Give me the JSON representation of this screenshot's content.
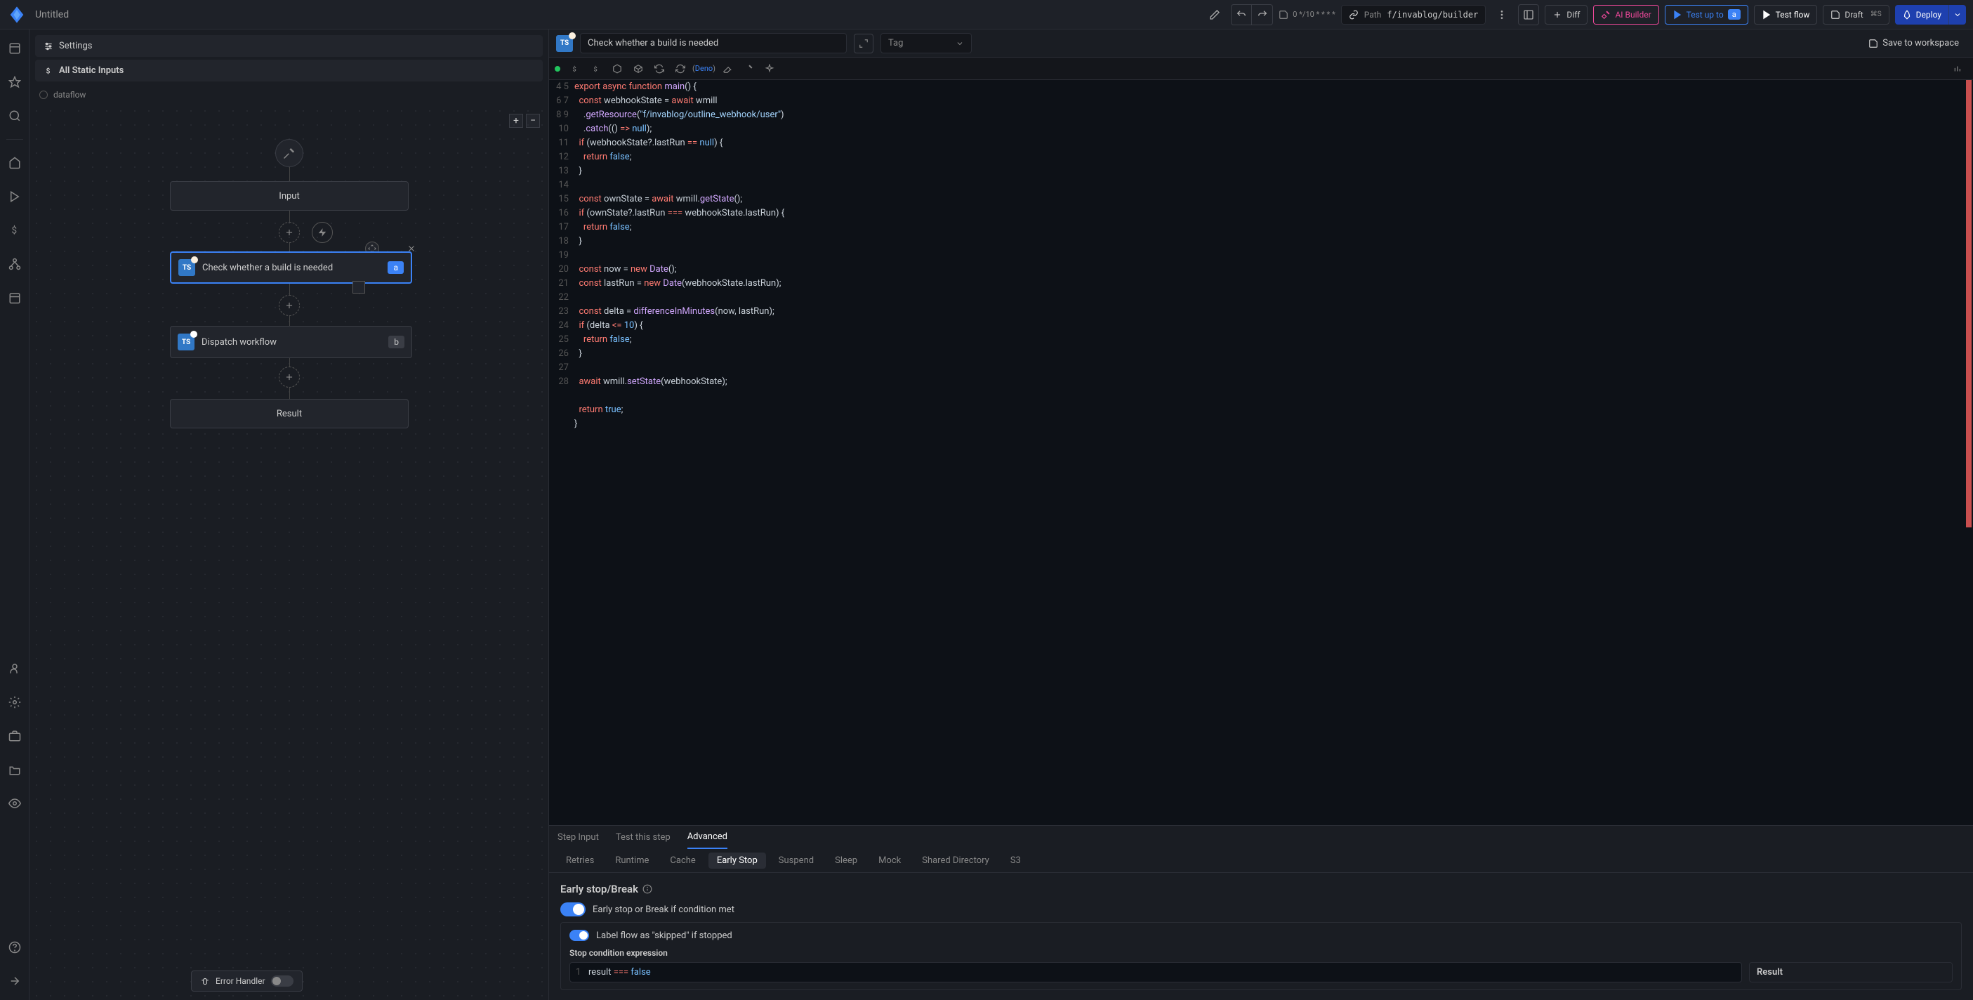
{
  "topbar": {
    "title": "Untitled",
    "save_status": "0 */10 * * * *",
    "path_label": "Path",
    "path_value": "f/invablog/builder",
    "diff_label": "Diff",
    "ai_builder_label": "AI Builder",
    "test_upto_label": "Test up to",
    "test_upto_badge": "a",
    "test_flow_label": "Test flow",
    "draft_label": "Draft",
    "draft_kbd": "⌘S",
    "deploy_label": "Deploy"
  },
  "left": {
    "settings_label": "Settings",
    "inputs_label": "All Static Inputs",
    "dataflow_label": "dataflow",
    "node_input": "Input",
    "node_result": "Result",
    "step_a": {
      "label": "Check whether a build is needed",
      "letter": "a"
    },
    "step_b": {
      "label": "Dispatch workflow",
      "letter": "b"
    },
    "error_handler": "Error Handler"
  },
  "right": {
    "step_name": "Check whether a build is needed",
    "tag_placeholder": "Tag",
    "save_workspace": "Save to workspace",
    "deno_label_prefix": "(",
    "deno_label_lang": "Deno",
    "deno_label_suffix": ")",
    "code": {
      "lines": [
        4,
        5,
        6,
        7,
        8,
        9,
        10,
        11,
        12,
        13,
        14,
        15,
        16,
        17,
        18,
        19,
        20,
        21,
        22,
        23,
        24,
        25,
        26,
        27,
        28
      ]
    },
    "step_tabs": [
      "Step Input",
      "Test this step",
      "Advanced"
    ],
    "step_tab_active": 2,
    "adv_tabs": [
      "Retries",
      "Runtime",
      "Cache",
      "Early Stop",
      "Suspend",
      "Sleep",
      "Mock",
      "Shared Directory",
      "S3"
    ],
    "adv_tab_active": 3,
    "early_stop": {
      "title": "Early stop/Break",
      "toggle1_label": "Early stop or Break if condition met",
      "toggle2_label": "Label flow as \"skipped\" if stopped",
      "expr_label": "Stop condition expression",
      "expr_line": "1",
      "expr_code_ident": "result",
      "expr_code_op": "===",
      "expr_code_bool": "false",
      "result_label": "Result"
    }
  }
}
